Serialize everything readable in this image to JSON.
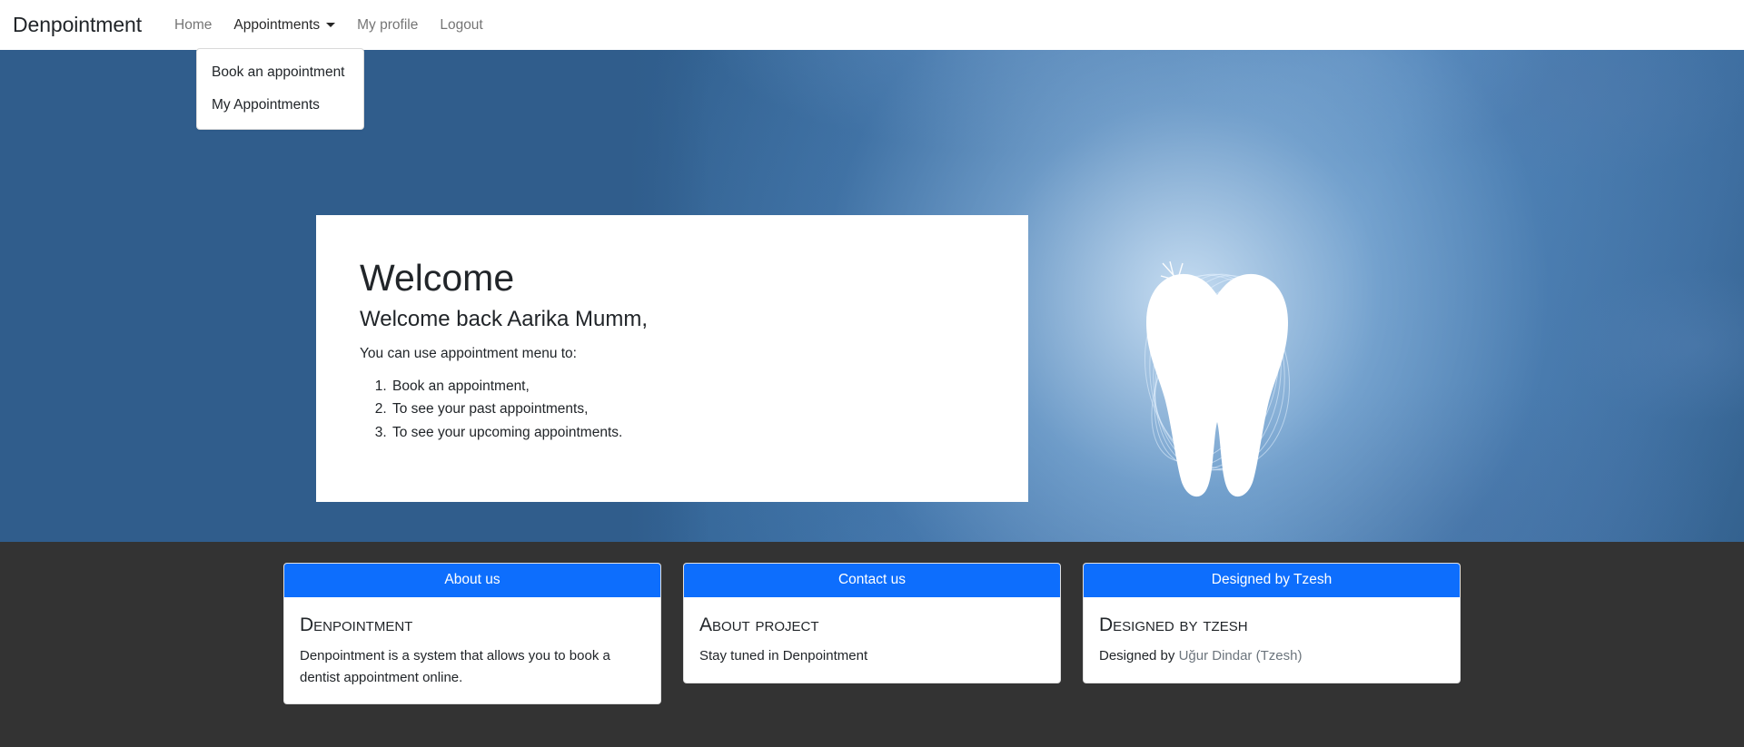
{
  "navbar": {
    "brand": "Denpointment",
    "links": [
      {
        "label": "Home",
        "active": false
      },
      {
        "label": "Appointments",
        "active": true,
        "has_caret": true
      },
      {
        "label": "My profile",
        "active": false
      },
      {
        "label": "Logout",
        "active": false
      }
    ]
  },
  "dropdown": {
    "open": true,
    "items": [
      {
        "label": "Book an appointment"
      },
      {
        "label": "My Appointments"
      }
    ]
  },
  "hero": {
    "background_color": "#305d8c",
    "illustration": "tooth-illustration"
  },
  "welcome": {
    "title": "Welcome",
    "subtitle": "Welcome back Aarika Mumm,",
    "lead": "You can use appointment menu to:",
    "list": [
      "Book an appointment,",
      "To see your past appointments,",
      "To see your upcoming appointments."
    ]
  },
  "footer": {
    "background_color": "#333333",
    "accent_color": "#0d6efd",
    "cards": [
      {
        "header": "About us",
        "title": "Denpointment",
        "text": "Denpointment is a system that allows you to book a dentist appointment online."
      },
      {
        "header": "Contact us",
        "title": "About project",
        "text": "Stay tuned in Denpointment"
      },
      {
        "header": "Designed by Tzesh",
        "title": "Designed by Tzesh",
        "text_prefix": "Designed by ",
        "text_link": "Uğur Dindar (Tzesh)"
      }
    ]
  }
}
